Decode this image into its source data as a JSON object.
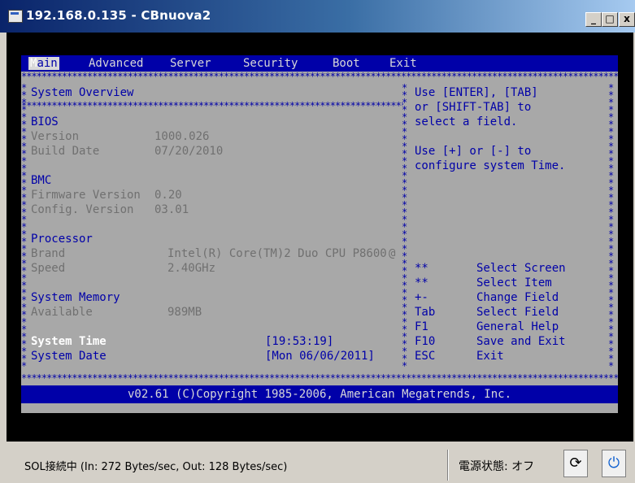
{
  "window": {
    "title": "192.168.0.135 - CBnuova2",
    "min_label": "_",
    "max_label": "□",
    "close_label": "x"
  },
  "bios": {
    "menu": [
      "Main",
      "Advanced",
      "Server",
      "Security",
      "Boot",
      "Exit"
    ],
    "active_menu": "Main",
    "system_overview": "System Overview",
    "bios_label": "BIOS",
    "version_label": "Version",
    "version_value": "1000.026",
    "build_date_label": "Build Date",
    "build_date_value": "07/20/2010",
    "bmc_label": "BMC",
    "firmware_label": "Firmware Version",
    "firmware_value": "0.20",
    "config_label": "Config. Version",
    "config_value": "03.01",
    "processor_label": "Processor",
    "brand_label": "Brand",
    "brand_value": "Intel(R) Core(TM)2 Duo CPU P8600",
    "brand_suffix": "@",
    "speed_label": "Speed",
    "speed_value": "2.40GHz",
    "memory_label": "System Memory",
    "available_label": "Available",
    "available_value": "989MB",
    "time_label": "System Time",
    "time_value": "[19:53:19]",
    "date_label": "System Date",
    "date_value": "[Mon 06/06/2011]",
    "help_lines": [
      "Use [ENTER], [TAB]",
      "or [SHIFT-TAB] to",
      "select a field.",
      "",
      "Use [+] or [-] to",
      "configure system Time."
    ],
    "keys": [
      {
        "key": "**",
        "desc": "Select Screen"
      },
      {
        "key": "**",
        "desc": "Select Item"
      },
      {
        "key": "+-",
        "desc": "Change Field"
      },
      {
        "key": "Tab",
        "desc": "Select Field"
      },
      {
        "key": "F1",
        "desc": "General Help"
      },
      {
        "key": "F10",
        "desc": "Save and Exit"
      },
      {
        "key": "ESC",
        "desc": "Exit"
      }
    ],
    "footer": "v02.61 (C)Copyright 1985-2006, American Megatrends, Inc."
  },
  "statusbar": {
    "sol_status": "SOL接続中 (In: 272 Bytes/sec, Out: 128 Bytes/sec)",
    "power_status": "電源状態: オフ"
  },
  "icons": {
    "refresh": "refresh-icon",
    "power": "power-icon"
  }
}
